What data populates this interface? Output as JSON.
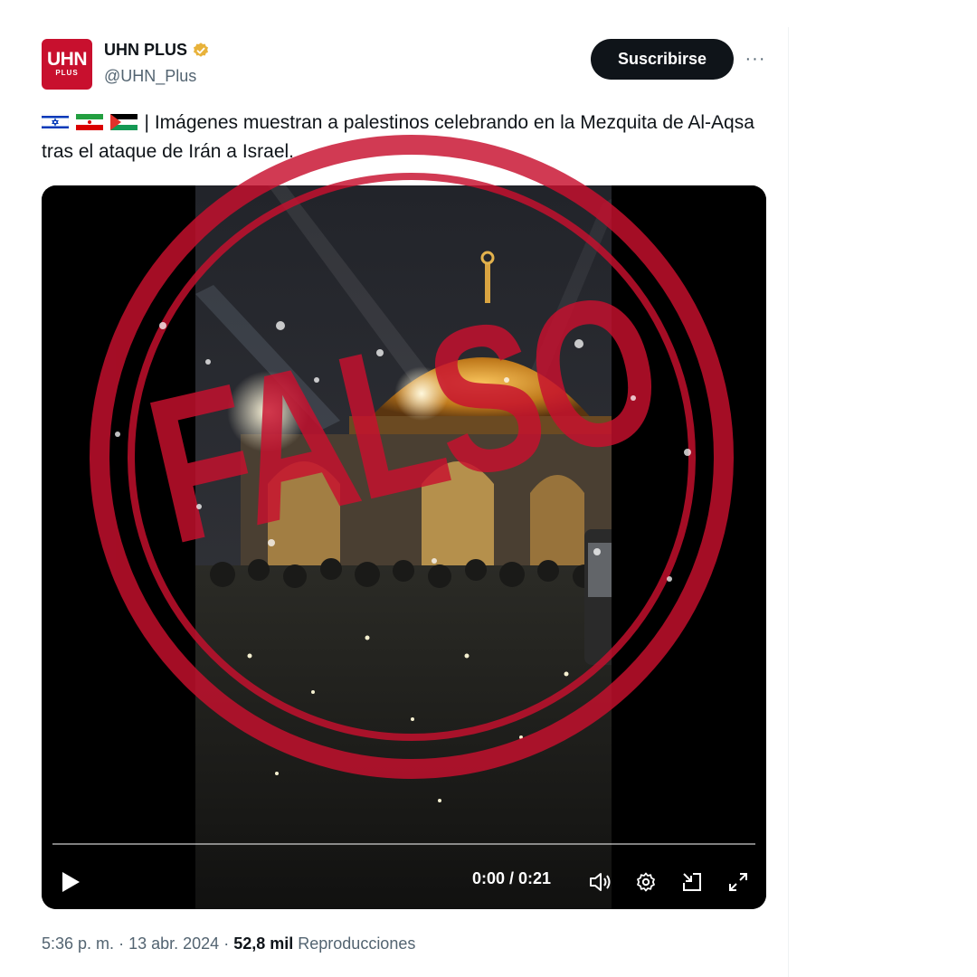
{
  "account": {
    "avatar_text": "UHN",
    "avatar_subtext": "PLUS",
    "display_name": "UHN PLUS",
    "handle": "@UHN_Plus",
    "verified_icon": "verified-badge-icon"
  },
  "actions": {
    "subscribe_label": "Suscribirse",
    "more_label": "···"
  },
  "tweet": {
    "flags": [
      "israel-flag-icon",
      "iran-flag-icon",
      "palestine-flag-icon"
    ],
    "text": "| Imágenes muestran a palestinos celebrando en la Mezquita de Al-Aqsa tras el ataque de Irán a Israel."
  },
  "video": {
    "time": "0:00 / 0:21",
    "progress": 0,
    "controls": [
      "play-icon",
      "volume-icon",
      "settings-icon",
      "dock-icon",
      "fullscreen-icon"
    ]
  },
  "stamp": {
    "text": "FALSO",
    "color": "#c8102e"
  },
  "meta": {
    "time": "5:36 p. m.",
    "separator": "·",
    "date": "13 abr. 2024",
    "views": "52,8 mil",
    "views_label": "Reproducciones"
  }
}
